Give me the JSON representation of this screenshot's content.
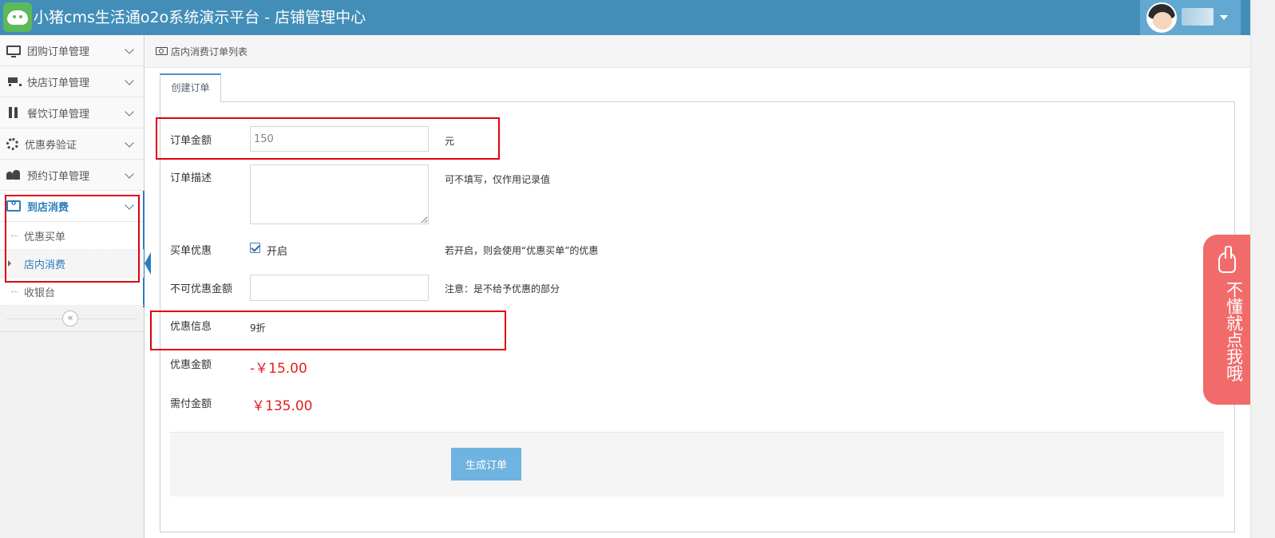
{
  "header": {
    "title": "小猪cms生活通o2o系统演示平台 - 店铺管理中心"
  },
  "sidebar": {
    "items": [
      {
        "label": "团购订单管理",
        "icon": "monitor-icon"
      },
      {
        "label": "快店订单管理",
        "icon": "cart-icon"
      },
      {
        "label": "餐饮订单管理",
        "icon": "food-icon"
      },
      {
        "label": "优惠券验证",
        "icon": "gear-icon"
      },
      {
        "label": "预约订单管理",
        "icon": "users-icon"
      },
      {
        "label": "到店消费",
        "icon": "money-icon",
        "active": true
      }
    ],
    "submenu": [
      {
        "label": "优惠买单"
      },
      {
        "label": "店内消费",
        "active": true
      },
      {
        "label": "收银台"
      }
    ],
    "collapse_glyph": "«"
  },
  "breadcrumb": {
    "label": "店内消费订单列表"
  },
  "tab": {
    "label": "创建订单"
  },
  "form": {
    "amount": {
      "label": "订单金额",
      "value": "150",
      "unit": "元"
    },
    "description": {
      "label": "订单描述",
      "value": "",
      "hint": "可不填写，仅作用记录值"
    },
    "discount_toggle": {
      "label": "买单优惠",
      "checked": true,
      "option_label": "开启",
      "hint": "若开启，则会使用“优惠买单”的优惠"
    },
    "non_discount_amount": {
      "label": "不可优惠金额",
      "value": "",
      "hint": "注意：是不给予优惠的部分"
    },
    "discount_info": {
      "label": "优惠信息",
      "value": "9折"
    },
    "discount_amount": {
      "label": "优惠金额",
      "value": "-￥15.00"
    },
    "payable_amount": {
      "label": "需付金额",
      "value": "￥135.00"
    },
    "submit_label": "生成订单"
  },
  "help": {
    "label": "不懂就点我哦"
  },
  "colors": {
    "header_bg": "#438eb9",
    "accent": "#2b7dbc",
    "price_red": "#e41e1e",
    "help_bg": "#f26b6b",
    "button_bg": "#6fb3e0",
    "highlight_frame": "#e0000f"
  }
}
